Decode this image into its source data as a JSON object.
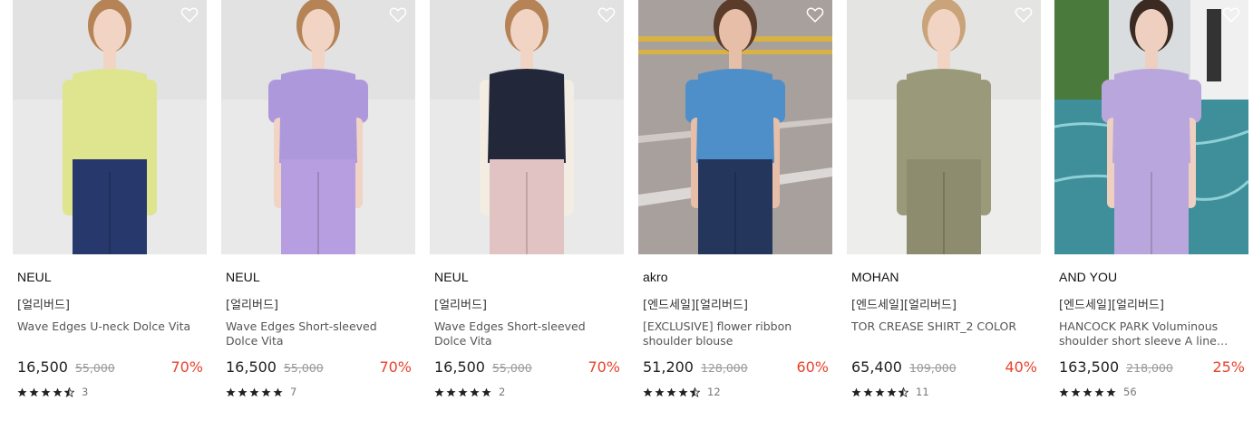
{
  "products": [
    {
      "brand": "NEUL",
      "tag": "[얼리버드]",
      "title": "Wave Edges U-neck Dolce Vita",
      "price": "16,500",
      "original_price": "55,000",
      "discount": "70%",
      "rating": 4.5,
      "review_count": "3",
      "image": {
        "bg": "#e9e9ea",
        "top": "#dfe48f",
        "bottom": "#27396c",
        "skin": "#f1d4c4",
        "hair": "#b58355"
      }
    },
    {
      "brand": "NEUL",
      "tag": "[얼리버드]",
      "title": "Wave Edges Short-sleeved Dolce Vita",
      "price": "16,500",
      "original_price": "55,000",
      "discount": "70%",
      "rating": 5,
      "review_count": "7",
      "image": {
        "bg": "#e9e9ea",
        "top": "#ad98dc",
        "bottom": "#b79ee0",
        "skin": "#f1d4c4",
        "hair": "#b58355"
      }
    },
    {
      "brand": "NEUL",
      "tag": "[얼리버드]",
      "title": "Wave Edges Short-sleeved Dolce Vita",
      "price": "16,500",
      "original_price": "55,000",
      "discount": "70%",
      "rating": 5,
      "review_count": "2",
      "image": {
        "bg": "#e9e9ea",
        "top": "#22283a",
        "bottom": "#e2c3c4",
        "skin": "#f1d4c4",
        "hair": "#b58355"
      }
    },
    {
      "brand": "akro",
      "tag": "[엔드세일][얼리버드]",
      "title": "[EXCLUSIVE] flower ribbon shoulder blouse",
      "price": "51,200",
      "original_price": "128,000",
      "discount": "60%",
      "rating": 4.5,
      "review_count": "12",
      "image": {
        "bg": "#a39c98",
        "top": "#4f8fc9",
        "bottom": "#24365c",
        "skin": "#e7bfa8",
        "hair": "#5b3b29"
      }
    },
    {
      "brand": "MOHAN",
      "tag": "[엔드세일][얼리버드]",
      "title": "TOR CREASE SHIRT_2 COLOR",
      "price": "65,400",
      "original_price": "109,000",
      "discount": "40%",
      "rating": 4.5,
      "review_count": "11",
      "image": {
        "bg": "#ededeb",
        "top": "#9a9a7a",
        "bottom": "#8e8c6e",
        "skin": "#f1d4c4",
        "hair": "#c9a47a"
      }
    },
    {
      "brand": "AND YOU",
      "tag": "[엔드세일][얼리버드]",
      "title": "HANCOCK PARK Voluminous shoulder short sleeve A line shi...",
      "price": "163,500",
      "original_price": "218,000",
      "discount": "25%",
      "rating": 5,
      "review_count": "56",
      "image": {
        "bg": "#3f8f9a",
        "top": "#b9a6dc",
        "bottom": "#b9a6dc",
        "skin": "#efd0c0",
        "hair": "#3a2a22"
      }
    }
  ]
}
